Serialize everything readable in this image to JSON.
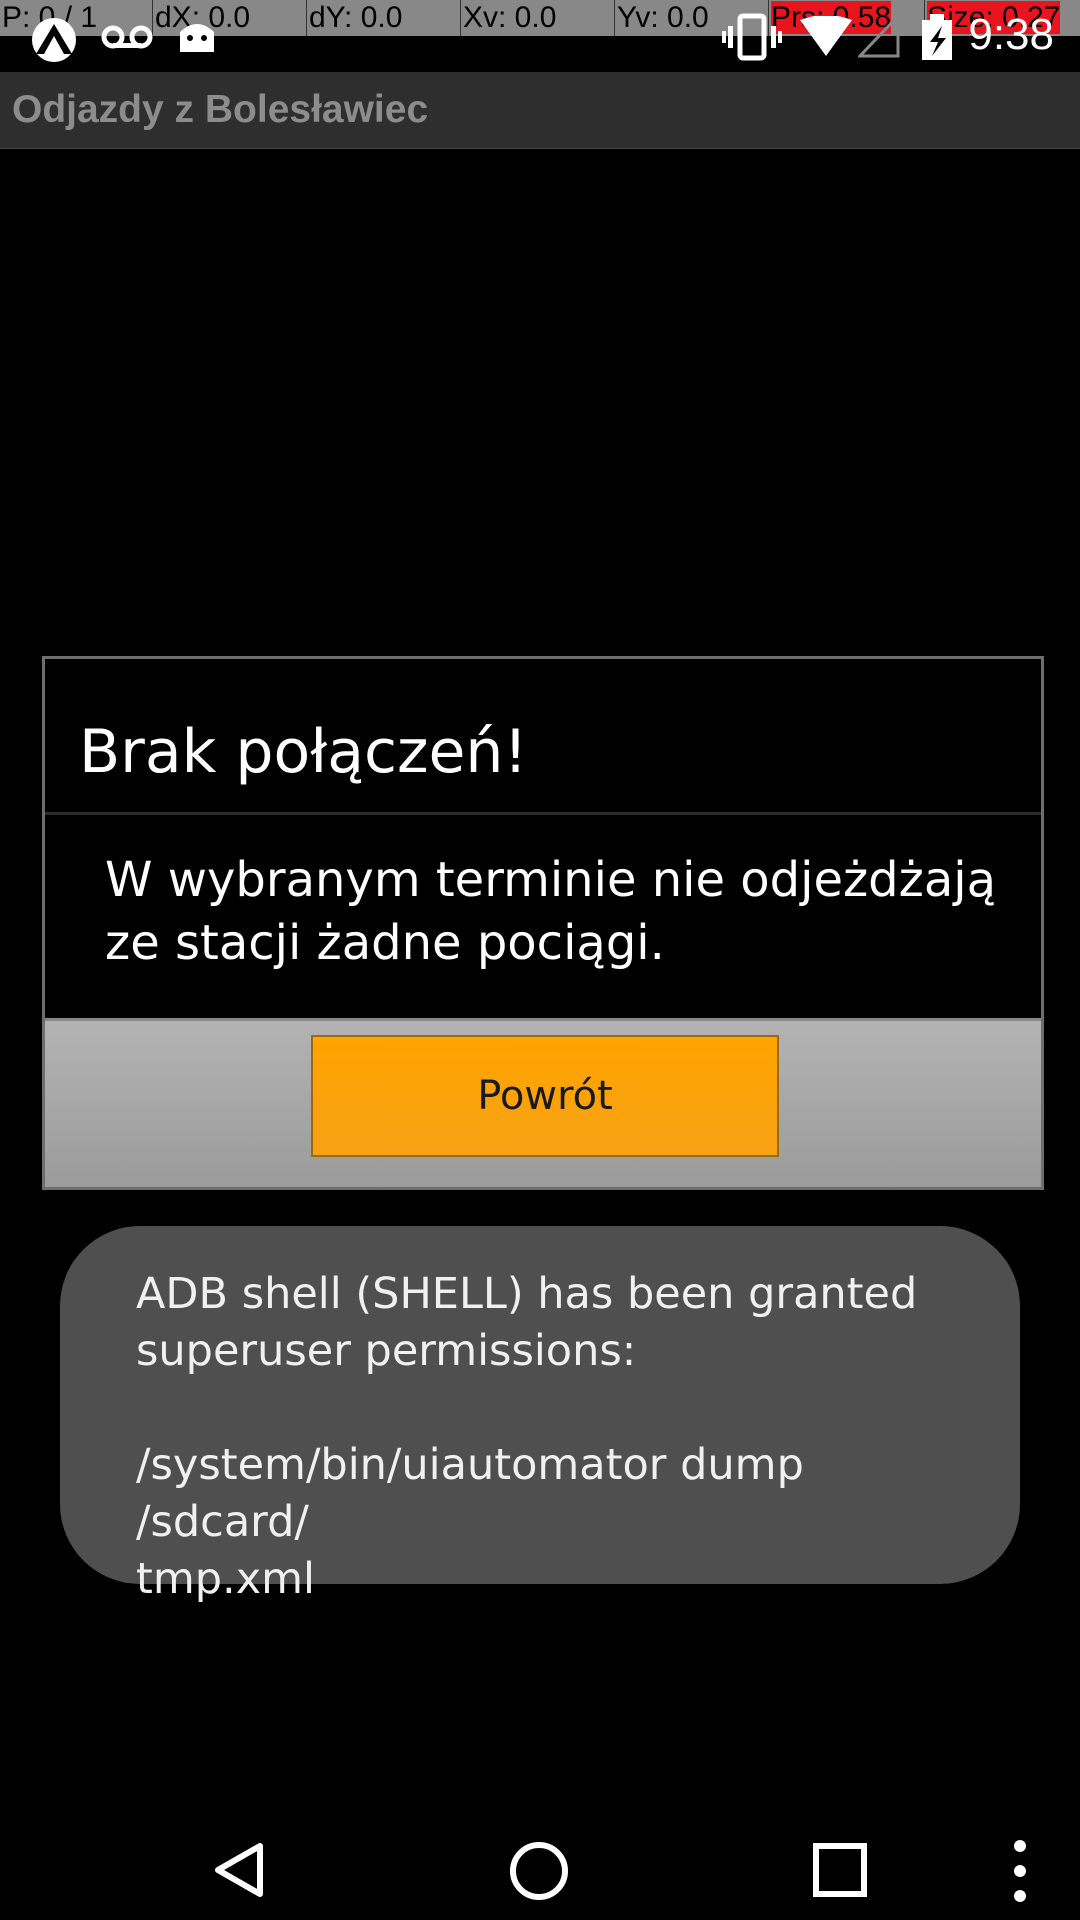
{
  "debug": {
    "p": "P: 0 / 1",
    "dx": "dX: 0.0",
    "dy": "dY: 0.0",
    "xv": "Xv: 0.0",
    "yv": "Yv: 0.0",
    "prs": "Prs: 0.58",
    "size": "Size: 0.27"
  },
  "status_bar": {
    "time": "9:38",
    "icons": [
      "app-notification-icon",
      "voicemail-icon",
      "android-icon",
      "vibrate-icon",
      "wifi-icon",
      "signal-icon",
      "battery-charging-icon"
    ]
  },
  "app": {
    "title": "Odjazdy z Bolesławiec"
  },
  "dialog": {
    "title": "Brak połączeń!",
    "message": "W wybranym terminie nie odjeżdżają ze stacji żadne pociągi.",
    "button_label": "Powrót",
    "button_color": "#ffa400"
  },
  "toast": {
    "text": "ADB shell (SHELL) has been granted superuser permissions:\n\n/system/bin/uiautomator dump /sdcard/\ntmp.xml"
  },
  "nav": {
    "icons": [
      "back-icon",
      "home-icon",
      "recents-icon",
      "menu-icon"
    ]
  }
}
